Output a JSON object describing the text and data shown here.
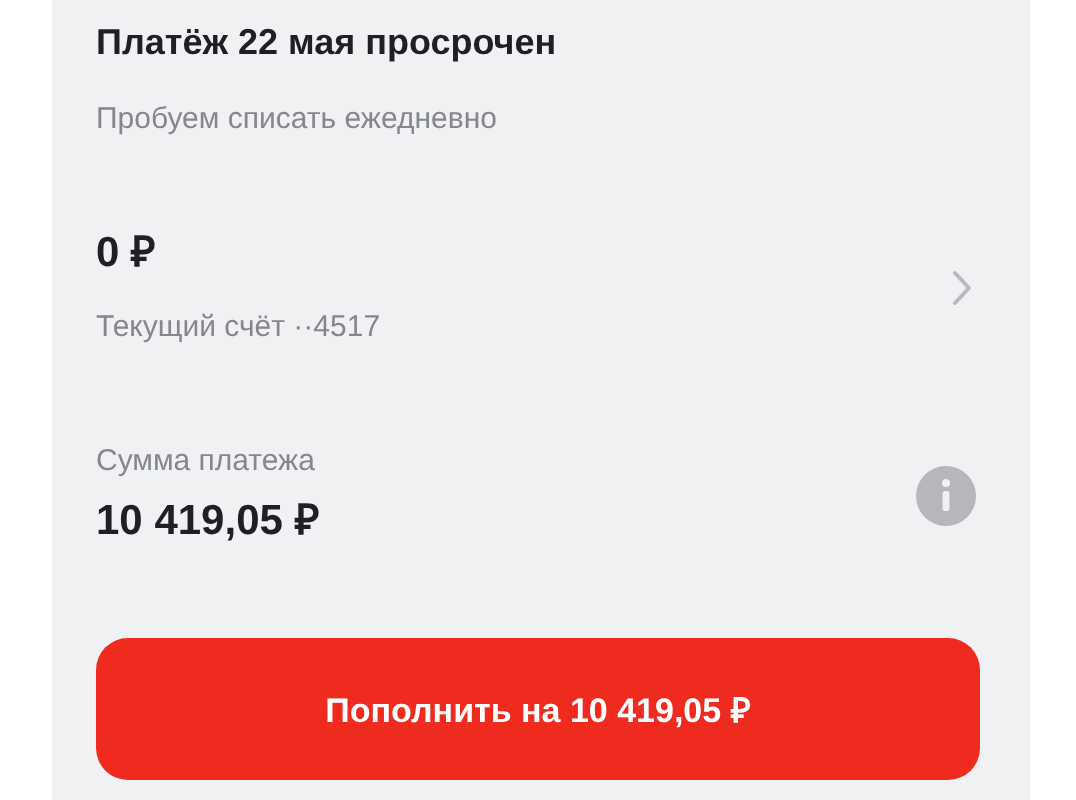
{
  "title": "Платёж 22 мая просрочен",
  "subtitle": "Пробуем списать ежедневно",
  "account": {
    "balance": "0 ₽",
    "name": "Текущий счёт ··4517"
  },
  "payment": {
    "label": "Сумма платежа",
    "amount": "10 419,05 ₽"
  },
  "button": "Пополнить на 10 419,05 ₽"
}
